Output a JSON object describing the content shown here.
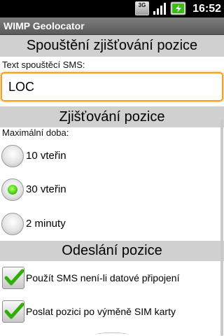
{
  "status_bar": {
    "network_badge": "3G",
    "time": "16:52",
    "signal_icon": "signal-bars-icon",
    "battery_icon": "battery-charging-icon"
  },
  "app": {
    "title": "WIMP Geolocator"
  },
  "sections": {
    "trigger": {
      "header": "Spouštění zjišťování pozice",
      "sms_label": "Text spouštěcí SMS:",
      "sms_value": "LOC"
    },
    "detection": {
      "header": "Zjišťování pozice",
      "max_time_label": "Maximální doba:",
      "options": [
        "10 vteřin",
        "30 vteřin",
        "2 minuty"
      ],
      "selected": "30 vteřin"
    },
    "sending": {
      "header": "Odeslání pozice",
      "checkboxes": [
        {
          "label": "Použít SMS není-li datové připojení",
          "checked": true
        },
        {
          "label": "Poslat pozici po výměně SIM karty",
          "checked": true
        }
      ]
    }
  },
  "colors": {
    "input_focus": "#ff9d1c",
    "check_green": "#2fae05",
    "section_bg": "#d0d0d0"
  }
}
